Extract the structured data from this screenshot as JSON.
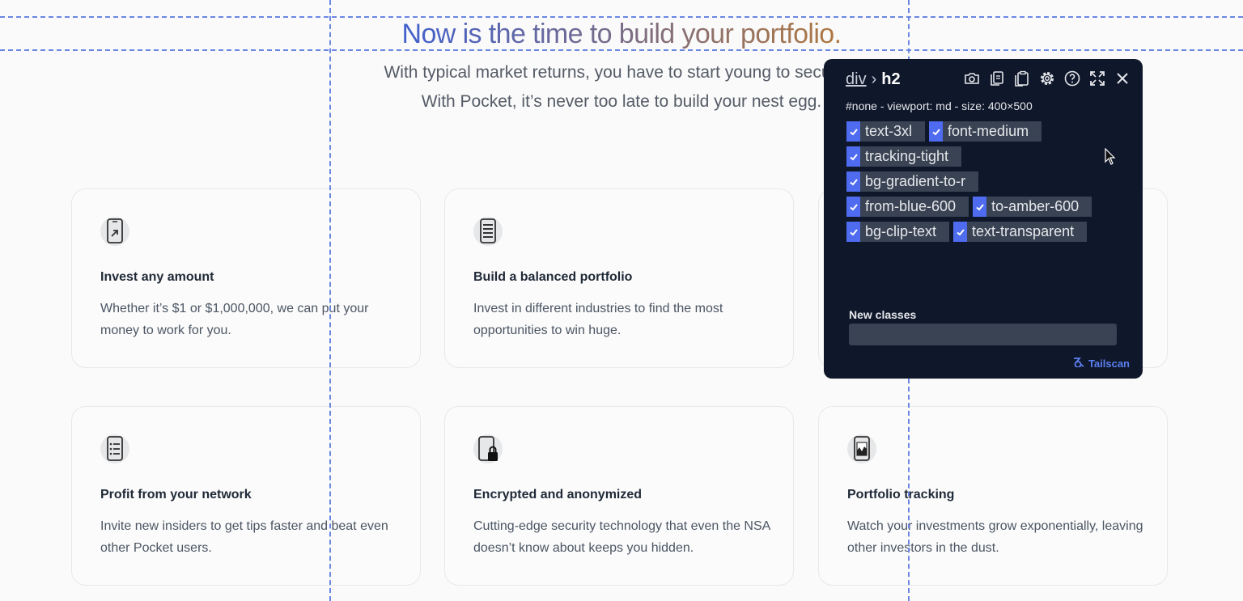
{
  "hero": {
    "headline": "Now is the time to build your portfolio.",
    "subtitle_line1": "With typical market returns, you have to start young to secure y",
    "subtitle_line2": "With Pocket, it’s never too late to build your nest egg."
  },
  "features": [
    {
      "title": "Invest any amount",
      "description": "Whether it’s $1 or $1,000,000, we can put your money to work for you.",
      "icon": "phone-arrow-icon"
    },
    {
      "title": "Build a balanced portfolio",
      "description": "Invest in different industries to find the most opportunities to win huge.",
      "icon": "phone-list-icon"
    },
    {
      "title": "",
      "description": "",
      "icon": ""
    },
    {
      "title": "Profit from your network",
      "description": "Invite new insiders to get tips faster and beat even other Pocket users.",
      "icon": "phone-checklist-icon"
    },
    {
      "title": "Encrypted and anonymized",
      "description": "Cutting-edge security technology that even the NSA doesn’t know about keeps you hidden.",
      "icon": "phone-lock-icon"
    },
    {
      "title": "Portfolio tracking",
      "description": "Watch your investments grow exponentially, leaving other investors in the dust.",
      "icon": "phone-chart-icon"
    }
  ],
  "inspector": {
    "breadcrumb_parent": "div",
    "breadcrumb_separator": "›",
    "breadcrumb_current": "h2",
    "meta": "#none - viewport: md - size: 400×500",
    "class_rows": [
      [
        "text-3xl",
        "font-medium"
      ],
      [
        "tracking-tight"
      ],
      [
        "bg-gradient-to-r"
      ],
      [
        "from-blue-600",
        "to-amber-600"
      ],
      [
        "bg-clip-text",
        "text-transparent"
      ]
    ],
    "new_classes_label": "New classes",
    "new_classes_value": "",
    "brand": "Tailscan",
    "tools": [
      "camera-icon",
      "copy-icon",
      "clipboard-icon",
      "gear-icon",
      "help-icon",
      "expand-icon",
      "close-icon"
    ]
  },
  "colors": {
    "gradient_from": "#3b5fd6",
    "gradient_to": "#b87a38",
    "panel_bg": "#0f172a",
    "chip_bg": "#3a4353",
    "check_bg": "#4f6cf0",
    "guide": "#6a86e4"
  }
}
